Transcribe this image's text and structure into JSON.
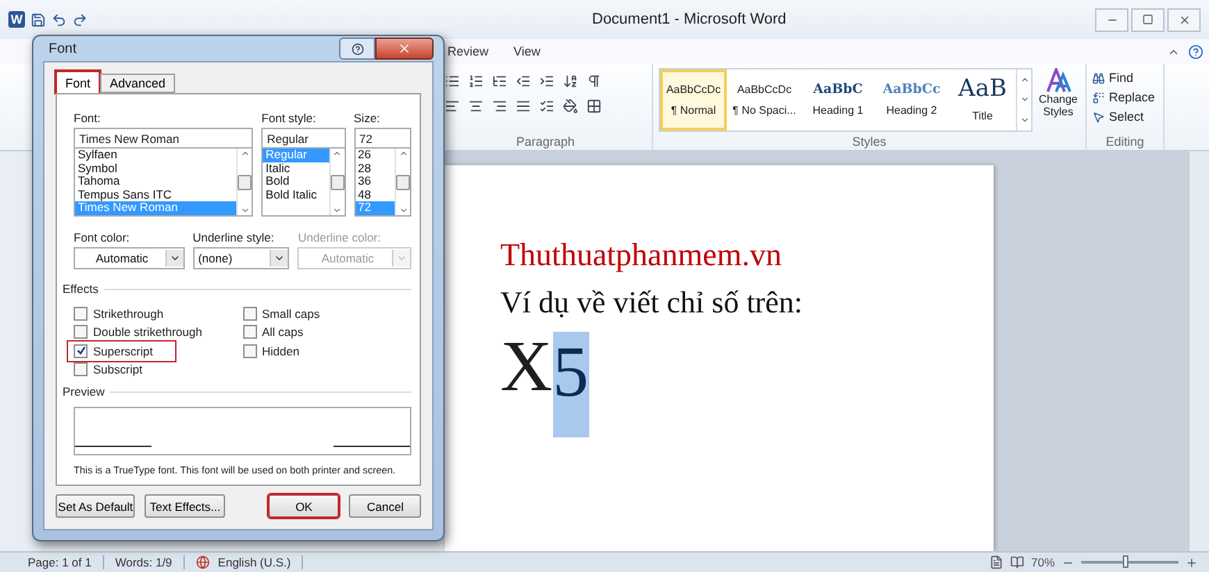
{
  "window": {
    "app_icon": "W",
    "title": "Document1  -  Microsoft Word"
  },
  "ribbon_tabs": [
    {
      "label": "Review"
    },
    {
      "label": "View"
    }
  ],
  "ribbon": {
    "paragraph_label": "Paragraph",
    "styles": [
      {
        "sample": "AaBbCcDc",
        "name": "¶ Normal",
        "kind": "normal",
        "selected": true
      },
      {
        "sample": "AaBbCcDc",
        "name": "¶ No Spaci...",
        "kind": "normal",
        "selected": false
      },
      {
        "sample": "AaBbC",
        "name": "Heading 1",
        "kind": "heading1",
        "selected": false
      },
      {
        "sample": "AaBbCc",
        "name": "Heading 2",
        "kind": "heading2",
        "selected": false
      },
      {
        "sample": "AaB",
        "name": "Title",
        "kind": "title",
        "selected": false
      }
    ],
    "change_styles": "Change Styles",
    "styles_label": "Styles",
    "editing": [
      "Find",
      "Replace",
      "Select"
    ],
    "editing_label": "Editing"
  },
  "document": {
    "lines": [
      {
        "kind": "heading",
        "text": "Thuthuatphanmem.vn"
      },
      {
        "kind": "body",
        "text": "Ví dụ về viết chỉ số trên:"
      },
      {
        "kind": "formula",
        "base": "X",
        "selected_text": "5"
      }
    ]
  },
  "status_bar": {
    "items": [
      "Page: 1 of 1",
      "Words: 1/9",
      "English (U.S.)"
    ],
    "zoom": "70%",
    "zoom_slider": {
      "level": 0.45
    }
  },
  "dialog": {
    "title": "Font",
    "tabs": [
      {
        "label": "Font",
        "selected": true,
        "highlighted": true
      },
      {
        "label": "Advanced",
        "selected": false,
        "highlighted": false
      }
    ],
    "font": {
      "label": "Font:",
      "value": "Times New Roman",
      "items": [
        {
          "label": "Sylfaen",
          "selected": false
        },
        {
          "label": "Symbol",
          "selected": false
        },
        {
          "label": "Tahoma",
          "selected": false
        },
        {
          "label": "Tempus Sans ITC",
          "selected": false
        },
        {
          "label": "Times New Roman",
          "selected": true
        }
      ]
    },
    "style": {
      "label": "Font style:",
      "value": "Regular",
      "items": [
        {
          "label": "Regular",
          "selected": true
        },
        {
          "label": "Italic",
          "selected": false
        },
        {
          "label": "Bold",
          "selected": false
        },
        {
          "label": "Bold Italic",
          "selected": false
        }
      ]
    },
    "size": {
      "label": "Size:",
      "value": "72",
      "items": [
        {
          "label": "26",
          "selected": false
        },
        {
          "label": "28",
          "selected": false
        },
        {
          "label": "36",
          "selected": false
        },
        {
          "label": "48",
          "selected": false
        },
        {
          "label": "72",
          "selected": true
        }
      ]
    },
    "combos": [
      {
        "label": "Font color:",
        "value": "Automatic",
        "disabled": false
      },
      {
        "label": "Underline style:",
        "value": "(none)",
        "disabled": false
      },
      {
        "label": "Underline color:",
        "value": "Automatic",
        "disabled": true
      }
    ],
    "effects": {
      "label": "Effects",
      "left": [
        {
          "label": "Strikethrough",
          "checked": false,
          "highlighted": false
        },
        {
          "label": "Double strikethrough",
          "checked": false,
          "highlighted": false
        },
        {
          "label": "Superscript",
          "checked": true,
          "highlighted": true
        },
        {
          "label": "Subscript",
          "checked": false,
          "highlighted": false
        }
      ],
      "right": [
        {
          "label": "Small caps",
          "checked": false,
          "highlighted": false
        },
        {
          "label": "All caps",
          "checked": false,
          "highlighted": false
        },
        {
          "label": "Hidden",
          "checked": false,
          "highlighted": false
        }
      ]
    },
    "preview_label": "Preview",
    "note": "This is a TrueType font. This font will be used on both printer and screen.",
    "buttons": [
      {
        "label": "Set As Default",
        "highlighted": false
      },
      {
        "label": "Text Effects...",
        "highlighted": false
      },
      {
        "label": "OK",
        "highlighted": true
      },
      {
        "label": "Cancel",
        "highlighted": false
      }
    ]
  }
}
